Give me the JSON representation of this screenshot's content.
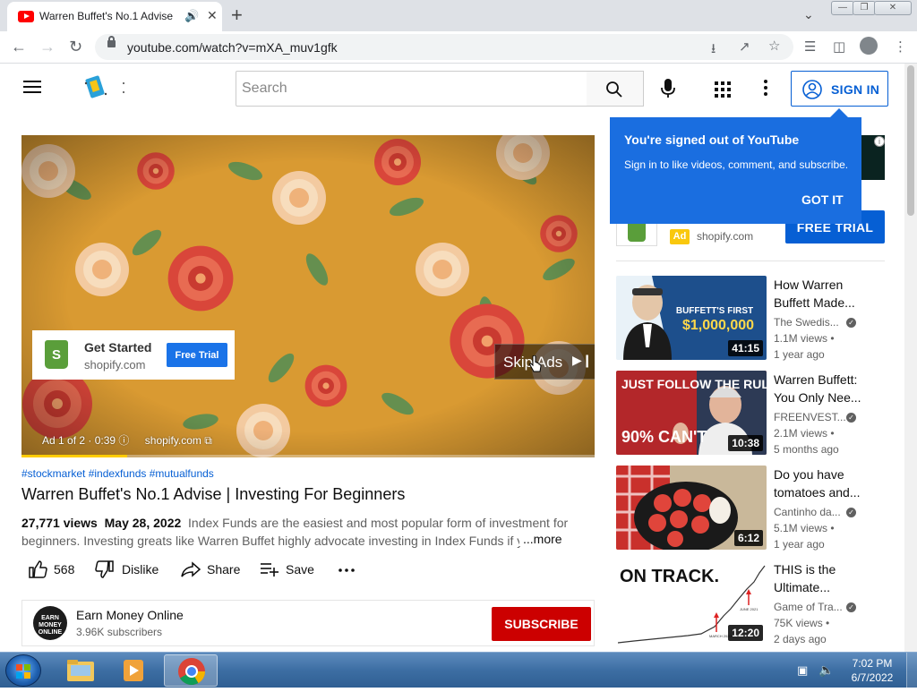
{
  "browser": {
    "tab_title": "Warren Buffet's No.1 Advise",
    "url": "youtube.com/watch?v=mXA_muv1gfk"
  },
  "masthead": {
    "search_placeholder": "Search",
    "signin_label": "SIGN IN"
  },
  "popup": {
    "heading": "You're signed out of YouTube",
    "body": "Sign in to like videos, comment, and subscribe.",
    "button": "GOT IT"
  },
  "player": {
    "ad_card": {
      "title": "Get Started",
      "domain": "shopify.com",
      "cta": "Free Trial"
    },
    "skip_label": "Skip Ads",
    "ad_counter": "Ad 1 of 2 · 0:39",
    "ad_domain": "shopify.com",
    "progress": 0.185
  },
  "video": {
    "hashtags": "#stockmarket #indexfunds #mutualfunds",
    "title": "Warren Buffet's No.1 Advise | Investing For Beginners",
    "views": "27,771 views",
    "date": "May 28, 2022",
    "description": "Index Funds are the easiest and most popular form of investment for beginners. Investing greats like Warren Buffet highly advocate investing in Index Funds if you",
    "more_label": "...more",
    "likes": "568",
    "dislike_label": "Dislike",
    "share_label": "Share",
    "save_label": "Save"
  },
  "channel": {
    "avatar_text": "EARN MONEY ONLINE",
    "name": "Earn Money Online",
    "subscribers": "3.96K subscribers",
    "subscribe_label": "SUBSCRIBE"
  },
  "side_ad": {
    "badge": "Ad",
    "domain": "shopify.com",
    "cta": "FREE TRIAL"
  },
  "recommendations": [
    {
      "title": "How Warren Buffett Made...",
      "channel": "The Swedis...",
      "views": "1.1M views •",
      "age": "1 year ago",
      "duration": "41:15",
      "thumb_text1": "BUFFETT'S FIRST",
      "thumb_text2": "$1,000,000"
    },
    {
      "title": "Warren Buffett: You Only Nee...",
      "channel": "FREENVEST...",
      "views": "2.1M views •",
      "age": "5 months ago",
      "duration": "10:38",
      "thumb_text1": "JUST FOLLOW THE RULES",
      "thumb_text2": "90% CAN'T"
    },
    {
      "title": "Do you have tomatoes and...",
      "channel": "Cantinho da...",
      "views": "5.1M views •",
      "age": "1 year ago",
      "duration": "6:12"
    },
    {
      "title": "THIS is the Ultimate...",
      "channel": "Game of Tra...",
      "views": "75K views •",
      "age": "2 days ago",
      "duration": "12:20",
      "thumb_text1": "ON TRACK.",
      "thumb_text2": "MARCH 2020",
      "thumb_text3": "JUNE 2021"
    }
  ],
  "taskbar": {
    "time": "7:02 PM",
    "date": "6/7/2022"
  }
}
